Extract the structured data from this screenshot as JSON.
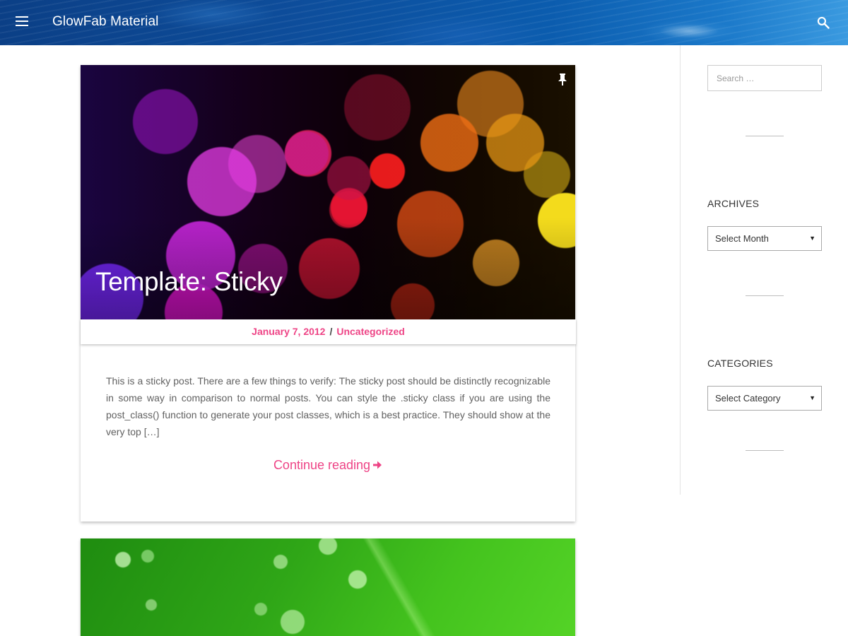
{
  "header": {
    "site_title": "GlowFab Material",
    "menu_icon": "hamburger-menu-icon",
    "search_icon": "search-icon",
    "text_color": "#ffffff"
  },
  "post": {
    "title": "Template: Sticky",
    "sticky_icon": "pin-icon",
    "date": "January 7, 2012",
    "separator": "/",
    "category": "Uncategorized",
    "excerpt": "This is a sticky post. There are a few things to verify: The sticky post should be distinctly recognizable in some way in comparison to normal posts. You can style the .sticky class if you are using the post_class() function to generate your post classes, which is a best practice. They should show at the very top […]",
    "continue_label": "Continue reading",
    "continue_icon": "arrow-right-icon",
    "accent_color": "#ee4486"
  },
  "sidebar": {
    "search_placeholder": "Search …",
    "archives": {
      "title": "ARCHIVES",
      "selected": "Select Month"
    },
    "categories": {
      "title": "CATEGORIES",
      "selected": "Select Category"
    }
  }
}
